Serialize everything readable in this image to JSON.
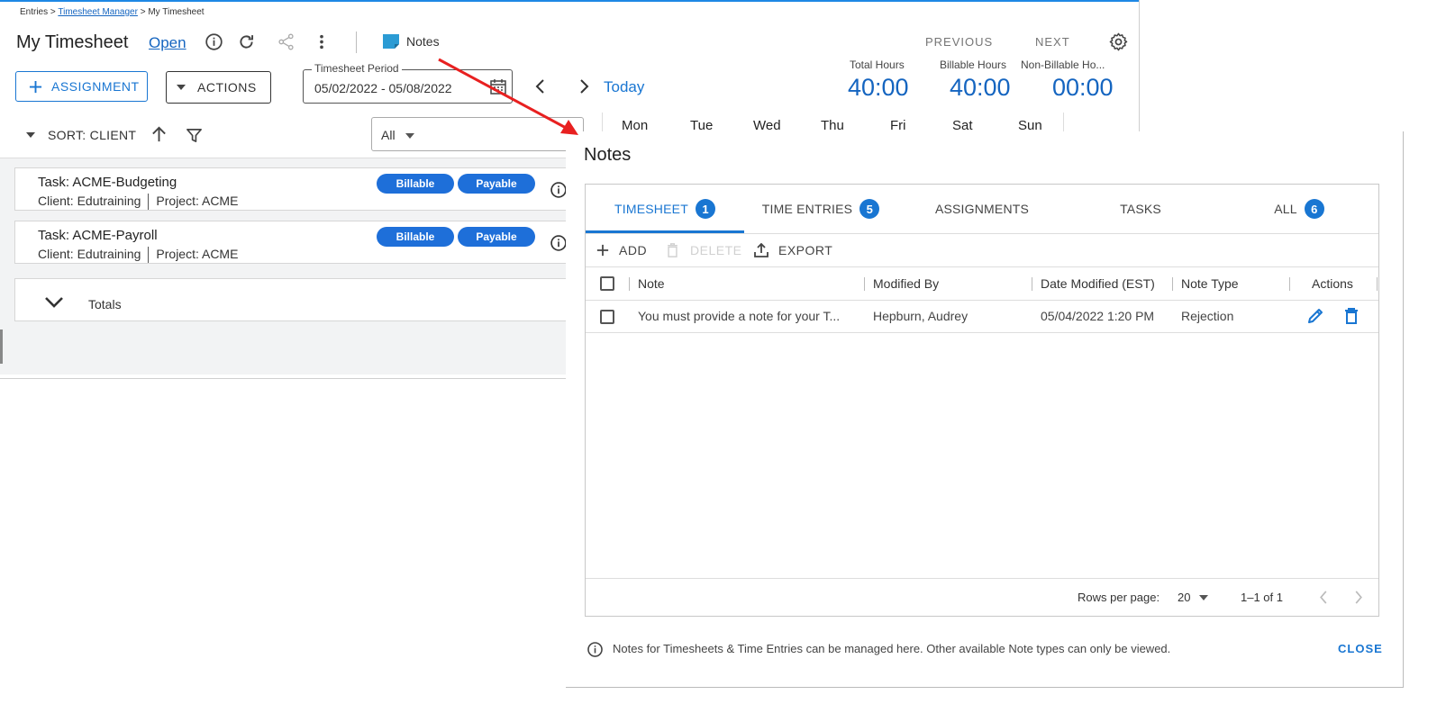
{
  "breadcrumb": {
    "items": [
      "Entries",
      "Timesheet Manager",
      "My Timesheet"
    ],
    "separator": ">"
  },
  "header": {
    "title": "My Timesheet",
    "status": "Open",
    "notes_label": "Notes",
    "previous_label": "PREVIOUS",
    "next_label": "NEXT",
    "icons": [
      "info-icon",
      "refresh-icon",
      "share-icon",
      "more-vert-icon",
      "note-icon",
      "gear-icon"
    ]
  },
  "toolbar": {
    "add_assignment_label": "ASSIGNMENT",
    "actions_label": "ACTIONS",
    "period_label": "Timesheet Period",
    "period_value": "05/02/2022 - 05/08/2022",
    "today_label": "Today"
  },
  "totals_summary": {
    "total_label": "Total Hours",
    "total_value": "40:00",
    "billable_label": "Billable Hours",
    "billable_value": "40:00",
    "nonbillable_label": "Non-Billable Ho...",
    "nonbillable_value": "00:00"
  },
  "sort_bar": {
    "sort_label": "SORT: CLIENT",
    "filter_value": "All"
  },
  "week_days": [
    "Mon",
    "Tue",
    "Wed",
    "Thu",
    "Fri",
    "Sat",
    "Sun"
  ],
  "tasks": [
    {
      "title": "Task: ACME-Budgeting",
      "client": "Client: Edutraining",
      "project": "Project: ACME",
      "badges": [
        "Billable",
        "Payable"
      ]
    },
    {
      "title": "Task: ACME-Payroll",
      "client": "Client: Edutraining",
      "project": "Project: ACME",
      "badges": [
        "Billable",
        "Payable"
      ]
    }
  ],
  "totals_row": {
    "label": "Totals"
  },
  "notes_dialog": {
    "title": "Notes",
    "tabs": [
      {
        "label": "TIMESHEET",
        "count": "1",
        "active": true
      },
      {
        "label": "TIME ENTRIES",
        "count": "5",
        "active": false
      },
      {
        "label": "ASSIGNMENTS",
        "count": "",
        "active": false
      },
      {
        "label": "TASKS",
        "count": "",
        "active": false
      },
      {
        "label": "ALL",
        "count": "6",
        "active": false
      }
    ],
    "actions": {
      "add": "ADD",
      "delete": "DELETE",
      "export": "EXPORT"
    },
    "columns": [
      "Note",
      "Modified By",
      "Date Modified (EST)",
      "Note Type",
      "Actions"
    ],
    "rows": [
      {
        "note": "You must provide a note for your T...",
        "modified_by": "Hepburn, Audrey",
        "date_modified": "05/04/2022 1:20 PM",
        "note_type": "Rejection"
      }
    ],
    "footer": {
      "rows_per_page_label": "Rows per page:",
      "rows_per_page_value": "20",
      "range": "1–1 of 1"
    },
    "info_text": "Notes for Timesheets & Time Entries can be managed here. Other available Note types can only be viewed.",
    "close_label": "CLOSE"
  },
  "colors": {
    "accent": "#1976d2",
    "badge_blue": "#1e6fd9",
    "annotation_arrow": "#e82020"
  }
}
